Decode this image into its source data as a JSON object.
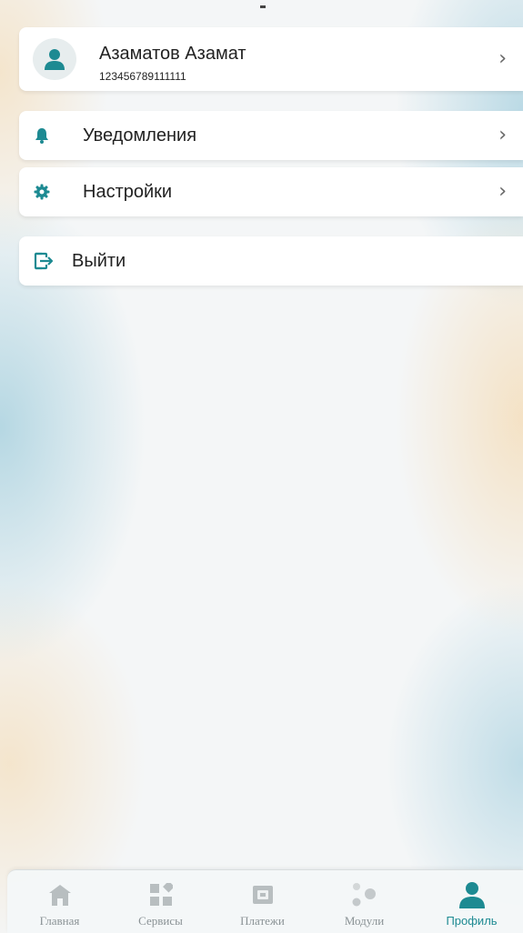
{
  "colors": {
    "accent": "#1d8a92",
    "inactive": "#b8bec0"
  },
  "profile": {
    "name": "Азаматов Азамат",
    "id": "123456789111111",
    "icon": "user-avatar-icon"
  },
  "menu": {
    "notifications": {
      "label": "Уведомления",
      "icon": "bell-icon"
    },
    "settings": {
      "label": "Настройки",
      "icon": "gear-icon"
    },
    "logout": {
      "label": "Выйти",
      "icon": "logout-icon"
    }
  },
  "tabbar": {
    "items": [
      {
        "label": "Главная",
        "icon": "home-icon",
        "active": false
      },
      {
        "label": "Сервисы",
        "icon": "services-icon",
        "active": false
      },
      {
        "label": "Платежи",
        "icon": "wallet-icon",
        "active": false
      },
      {
        "label": "Модули",
        "icon": "modules-icon",
        "active": false
      },
      {
        "label": "Профиль",
        "icon": "profile-icon",
        "active": true
      }
    ]
  }
}
